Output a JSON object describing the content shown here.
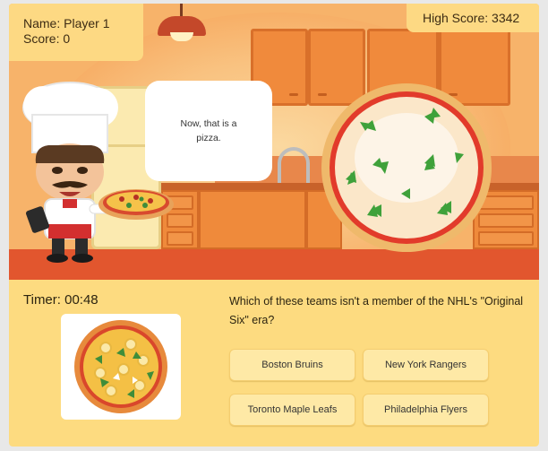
{
  "hud": {
    "player_name": "Name: Player 1",
    "score": "Score: 0",
    "high_score": "High Score: 3342"
  },
  "chef": {
    "speech": "Now, that is a pizza."
  },
  "quiz": {
    "timer": "Timer: 00:48",
    "question": "Which of these teams isn't a member of the NHL's \"Original Six\" era?",
    "answers": [
      "Boston Bruins",
      "New York Rangers",
      "Toronto Maple Leafs",
      "Philadelphia Flyers"
    ]
  },
  "colors": {
    "panel": "#fddb80",
    "answer_button": "#fee9a6",
    "floor": "#e2562e",
    "cabinet": "#ef8a3b"
  },
  "icons": {
    "lamp": "lamp-icon",
    "chef": "chef-character",
    "pizza": "pizza-icon"
  }
}
